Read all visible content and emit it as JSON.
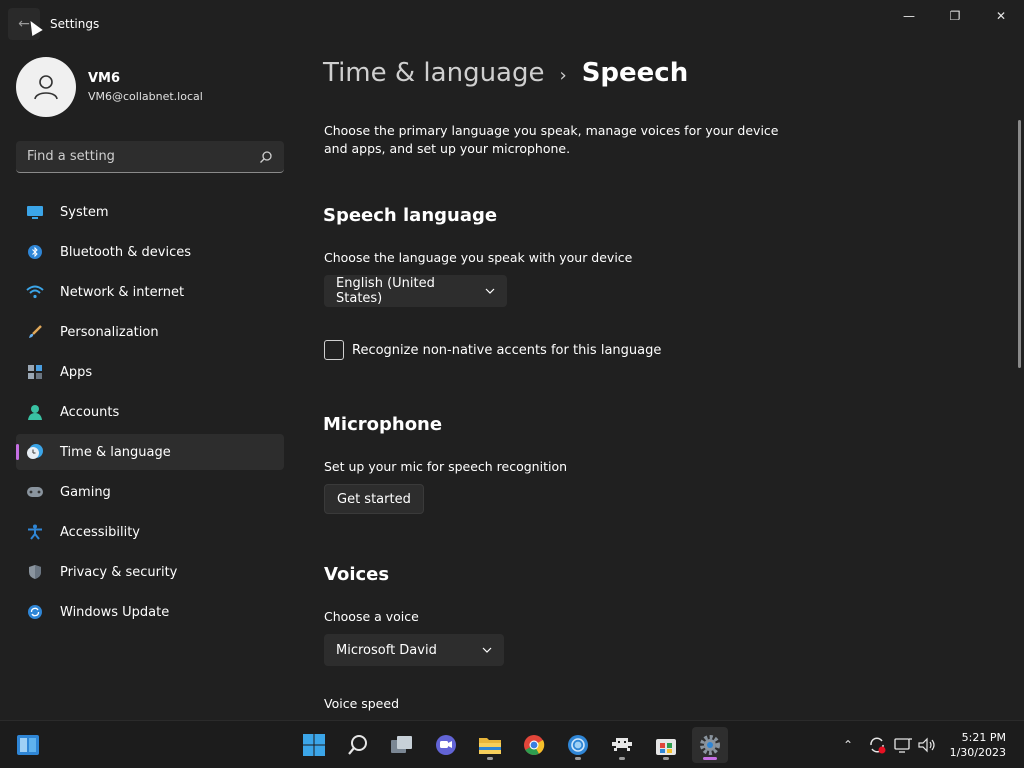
{
  "window": {
    "title": "Settings",
    "controls": {
      "minimize": "—",
      "maximize": "❐",
      "close": "✕"
    }
  },
  "profile": {
    "name": "VM6",
    "email": "VM6@collabnet.local"
  },
  "search": {
    "placeholder": "Find a setting"
  },
  "nav": {
    "items": [
      {
        "label": "System",
        "icon": "system-icon"
      },
      {
        "label": "Bluetooth & devices",
        "icon": "bluetooth-icon"
      },
      {
        "label": "Network & internet",
        "icon": "wifi-icon"
      },
      {
        "label": "Personalization",
        "icon": "brush-icon"
      },
      {
        "label": "Apps",
        "icon": "apps-icon"
      },
      {
        "label": "Accounts",
        "icon": "accounts-icon"
      },
      {
        "label": "Time & language",
        "icon": "time-language-icon",
        "active": true
      },
      {
        "label": "Gaming",
        "icon": "gaming-icon"
      },
      {
        "label": "Accessibility",
        "icon": "accessibility-icon"
      },
      {
        "label": "Privacy & security",
        "icon": "shield-icon"
      },
      {
        "label": "Windows Update",
        "icon": "update-icon"
      }
    ]
  },
  "breadcrumb": {
    "parent": "Time & language",
    "separator": "›",
    "current": "Speech"
  },
  "description": "Choose the primary language you speak, manage voices for your device and apps, and set up your microphone.",
  "speech_language": {
    "heading": "Speech language",
    "label": "Choose the language you speak with your device",
    "selected": "English (United States)",
    "checkbox_label": "Recognize non-native accents for this language",
    "checkbox_checked": false
  },
  "microphone": {
    "heading": "Microphone",
    "label": "Set up your mic for speech recognition",
    "button": "Get started"
  },
  "voices": {
    "heading": "Voices",
    "label": "Choose a voice",
    "selected": "Microsoft David",
    "speed_label": "Voice speed"
  },
  "taskbar": {
    "clock": {
      "time": "5:21 PM",
      "date": "1/30/2023"
    },
    "accent": "#c56fe3"
  }
}
